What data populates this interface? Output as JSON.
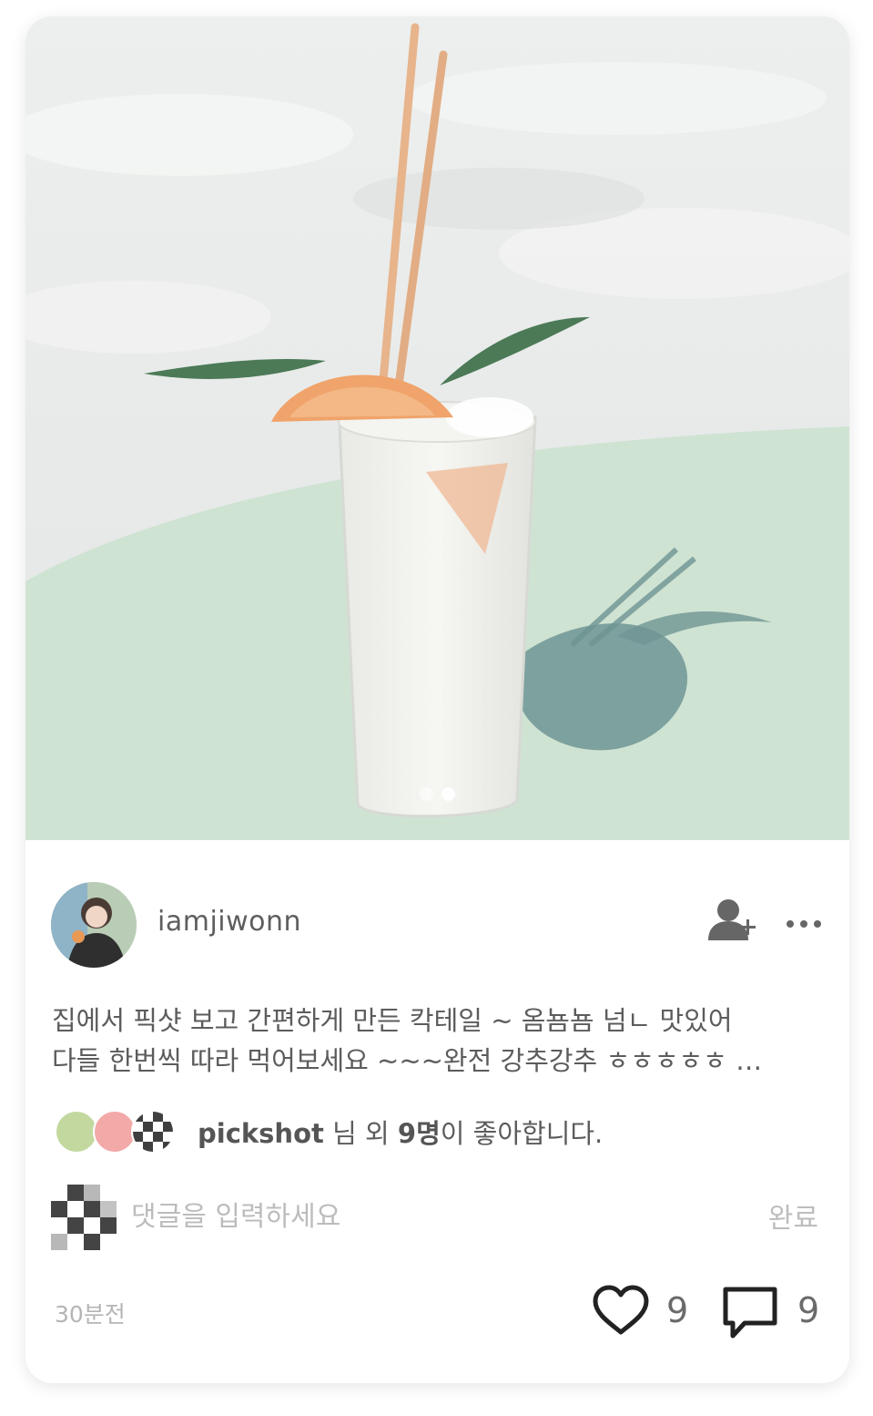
{
  "post": {
    "photo": {
      "alt": "cocktail",
      "carousel_count": 2,
      "carousel_active_index": 1
    },
    "author": {
      "username": "iamjiwonn",
      "follow_icon": "add-user-icon",
      "more_icon": "more-horizontal-icon"
    },
    "caption": {
      "line1": "집에서 픽샷 보고 간편하게 만든 칵테일 ~ 옴뇸뇸 넘ㄴ 맛있어",
      "line2": "다들 한번씩 따라 먹어보세요 ~~~완전 강추강추 ㅎㅎㅎㅎㅎ …"
    },
    "likes": {
      "first_user": "pickshot",
      "suffix_1": " 님 외 ",
      "others_count": "9명",
      "suffix_2": "이 좋아합니다.",
      "avatar_colors": [
        "#c3d89f",
        "#f2a9a8",
        "#3f3f3f"
      ]
    },
    "comment_box": {
      "placeholder": "댓글을 입력하세요",
      "submit_label": "완료"
    },
    "footer": {
      "timestamp": "30분전",
      "like_count": "9",
      "comment_count": "9",
      "like_icon": "heart-icon",
      "comment_icon": "speech-bubble-icon"
    }
  },
  "colors": {
    "text": "#5c5c5c",
    "muted": "#bdbdbd",
    "table_mint": "#cfe3d3"
  }
}
